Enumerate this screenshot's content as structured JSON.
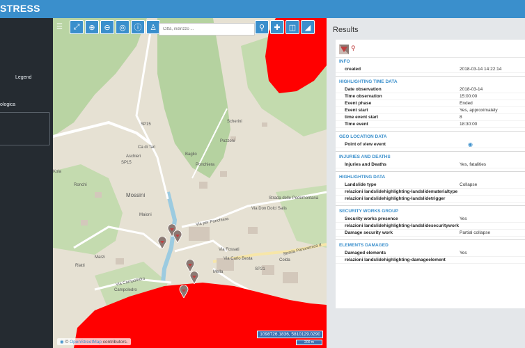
{
  "app": {
    "brand": "STRESS"
  },
  "sidebar": {
    "legend_label": "Legend",
    "layer_label": "ologica"
  },
  "map": {
    "search_placeholder": "Città, indirizzo ...",
    "attribution_symbol": "©",
    "attribution_link": "OpenStreetMap",
    "attribution_text": " contributors.",
    "coordinates": "1098726.1836, 5810129.0290",
    "scale_label": "200 m",
    "labels": {
      "sp15_a": "SP15",
      "sp15_b": "SP15",
      "sp21": "SP21",
      "ca_di_tari": "Ca di Tari",
      "aschieri": "Aschieri",
      "baglio": "Baglio",
      "ponchiera": "Ponchiera",
      "pozzoni": "Pozzoni",
      "scherini": "Scherini",
      "ronchi": "Ronchi",
      "mossini": "Mossini",
      "maioni": "Maioni",
      "marzi": "Marzi",
      "riatti": "Riatti",
      "campoledro": "Campoledro",
      "kola": "Kola",
      "via_campoledro": "Via Campoledro",
      "via_per_ponchiera": "Via per Ponchiera",
      "strada_panoramica": "Strada Panoramica d",
      "strada_pedemontana": "Strada delle Pedemontana",
      "via_dolci_salis": "Via Don Dolci Salis",
      "via_fossati": "Via Fossati",
      "via_colda": "Colda",
      "via_carlo_besta": "Via Carlo Besta",
      "la_mella": "Mella"
    }
  },
  "results": {
    "title": "Results",
    "sections": [
      {
        "title": "INFO",
        "rows": [
          {
            "k": "created",
            "v": "2018-03-14 14:22:14"
          }
        ]
      },
      {
        "title": "HIGHLIGHTING TIME DATA",
        "rows": [
          {
            "k": "Date observation",
            "v": "2018-03-14"
          },
          {
            "k": "Time observation",
            "v": "15:00:00"
          },
          {
            "k": "Event phase",
            "v": "Ended"
          },
          {
            "k": "Event start",
            "v": "Yes, approximately"
          },
          {
            "k": "time event start",
            "v": "8"
          },
          {
            "k": "Time event",
            "v": "18:30:00"
          }
        ]
      },
      {
        "title": "GEO LOCATION DATA",
        "rows": [
          {
            "k": "Point of view event",
            "v": ""
          }
        ]
      },
      {
        "title": "INJURIES AND DEATHS",
        "rows": [
          {
            "k": "Injuries and Deaths",
            "v": "Yes, fatalities"
          }
        ]
      },
      {
        "title": "HIGHLIGHTING DATA",
        "rows": [
          {
            "k": "Landslide type",
            "v": "Collapse"
          },
          {
            "k": "relazioni landslidehighlighting-landslidematerialtype",
            "v": ""
          },
          {
            "k": "relazioni landslidehighlighting-landslidetrigger",
            "v": ""
          }
        ]
      },
      {
        "title": "SECURITY WORKS GROUP",
        "rows": [
          {
            "k": "Security works presence",
            "v": "Yes"
          },
          {
            "k": "relazioni landslidehighlighting-landslidesecuritywork",
            "v": ""
          },
          {
            "k": "Damage security work",
            "v": "Partial collapse"
          }
        ]
      },
      {
        "title": "ELEMENTS DAMAGED",
        "rows": [
          {
            "k": "Damaged elements",
            "v": "Yes"
          },
          {
            "k": "relazioni landslidehighlighting-damageelement",
            "v": ""
          }
        ]
      }
    ]
  },
  "colors": {
    "accent": "#3a8fcc",
    "hazard": "#ff0000",
    "sidebar": "#252b31"
  },
  "icons": [
    "menu-icon",
    "zoom-extent-icon",
    "zoom-in-icon",
    "zoom-out-icon",
    "zoom-area-icon",
    "info-icon",
    "street-view-icon",
    "search-icon",
    "add-layer-icon",
    "split-view-icon",
    "measure-icon",
    "map-pin-icon",
    "eye-icon"
  ]
}
